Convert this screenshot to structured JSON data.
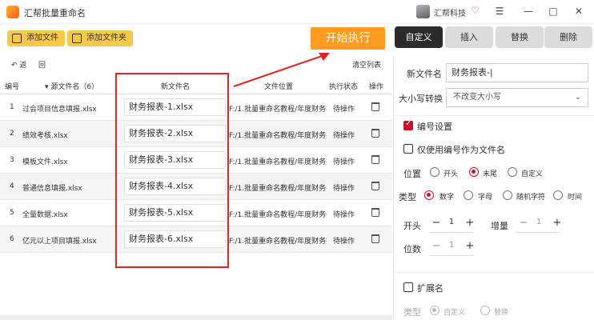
{
  "app": {
    "title": "汇帮批量重命名",
    "account": "汇帮科技"
  },
  "window": {
    "menu": "☰",
    "minimize": "—",
    "maximize": "□",
    "close": "✕"
  },
  "toolbar": {
    "add_file": "添加文件",
    "add_folder": "添加文件夹",
    "start": "开始执行"
  },
  "subbar": {
    "back": "返",
    "back_icon": "↶",
    "refresh": "回",
    "clear": "清空列表"
  },
  "table": {
    "headers": {
      "index": "编号",
      "source": "▾ 源文件名（6）",
      "newname": "新文件名",
      "path": "文件位置",
      "status": "执行状态",
      "action": "操作"
    },
    "rows": [
      {
        "index": "1",
        "source": "过会项目信息填报.xlsx",
        "newname": "财务报表-1.xlsx",
        "path": "F:/1.批量重命名教程/年度财务报表",
        "status": "待操作"
      },
      {
        "index": "2",
        "source": "绩效考核.xlsx",
        "newname": "财务报表-2.xlsx",
        "path": "F:/1.批量重命名教程/年度财务报表",
        "status": "待操作"
      },
      {
        "index": "3",
        "source": "模板文件.xlsx",
        "newname": "财务报表-3.xlsx",
        "path": "F:/1.批量重命名教程/年度财务报表",
        "status": "待操作"
      },
      {
        "index": "4",
        "source": "普通信息填报.xlsx",
        "newname": "财务报表-4.xlsx",
        "path": "F:/1.批量重命名教程/年度财务报表",
        "status": "待操作"
      },
      {
        "index": "5",
        "source": "全量数据.xlsx",
        "newname": "财务报表-5.xlsx",
        "path": "F:/1.批量重命名教程/年度财务报表",
        "status": "待操作"
      },
      {
        "index": "6",
        "source": "亿元以上项目填报.xlsx",
        "newname": "财务报表-6.xlsx",
        "path": "F:/1.批量重命名教程/年度财务报表",
        "status": "待操作"
      }
    ]
  },
  "tabs": [
    "自定义",
    "插入",
    "替换",
    "删除"
  ],
  "panel": {
    "newname_label": "新文件名",
    "newname_value": "财务报表-",
    "case_label": "大小写转换",
    "case_value": "不改变大小写",
    "numbering_label": "编号设置",
    "only_number_label": "仅使用编号作为文件名",
    "position_label": "位置",
    "position_options": [
      "开头",
      "末尾",
      "自定义"
    ],
    "type_label": "类型",
    "type_options": [
      "数字",
      "字母",
      "随机字符",
      "时间"
    ],
    "start_label": "开头",
    "start_value": "1",
    "step_label": "增量",
    "step_value": "1",
    "digits_label": "位数",
    "digits_value": "1",
    "ext_label": "扩展名",
    "ext_type_label": "类型",
    "ext_options": [
      "自定义",
      "替换"
    ],
    "minus": "−",
    "plus": "+"
  }
}
